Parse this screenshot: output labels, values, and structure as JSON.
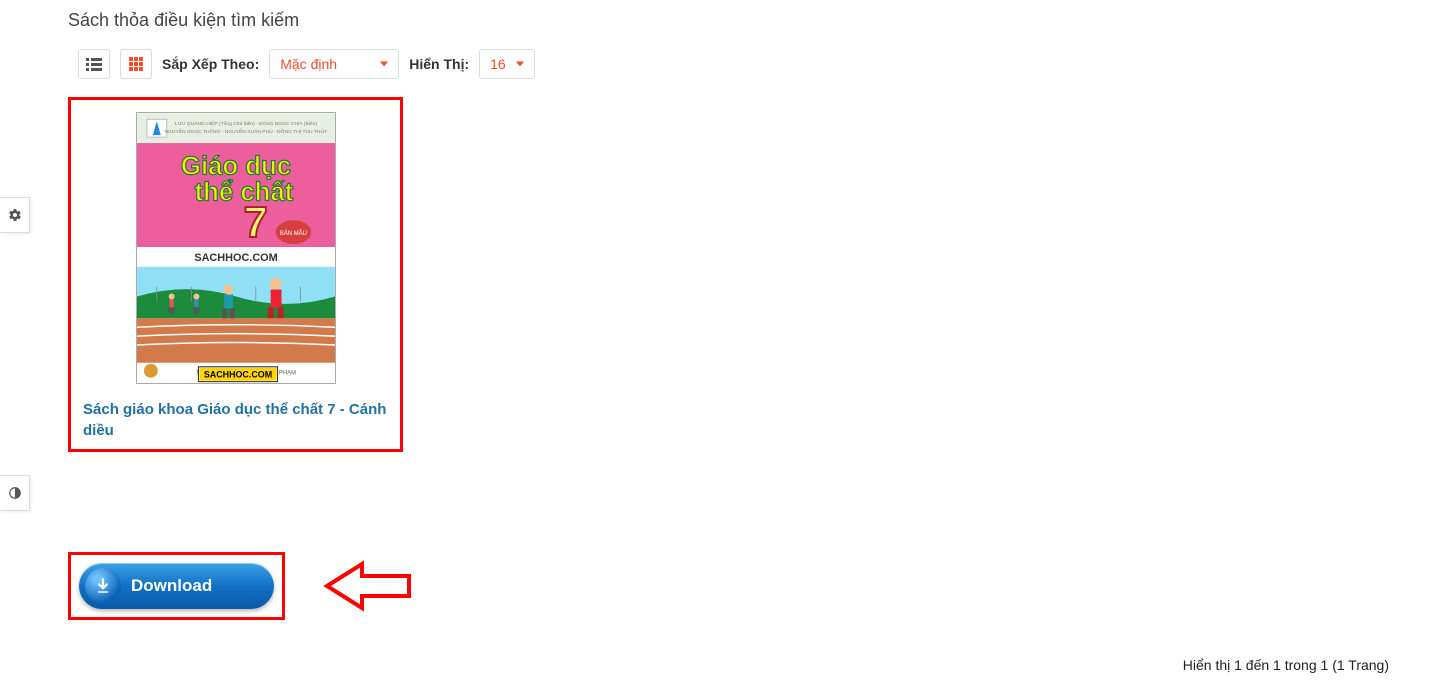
{
  "header": {
    "title": "Sách thỏa điều kiện tìm kiếm"
  },
  "toolbar": {
    "sort_label": "Sắp Xếp Theo:",
    "sort_value": "Mặc định",
    "show_label": "Hiển Thị:",
    "show_value": "16"
  },
  "product": {
    "title": "Sách giáo khoa Giáo dục thể chất 7 - Cánh diều",
    "cover": {
      "title_line1": "Giáo dục",
      "title_line2": "thể chất",
      "grade": "7",
      "watermark": "SACHHOC.COM",
      "bottom_badge": "SACHHOC.COM"
    }
  },
  "download": {
    "label": "Download"
  },
  "pager": {
    "text": "Hiển thị 1 đến 1 trong 1 (1 Trang)"
  },
  "colors": {
    "accent": "#f04e30",
    "link": "#2271a1",
    "annotation": "#f00"
  }
}
